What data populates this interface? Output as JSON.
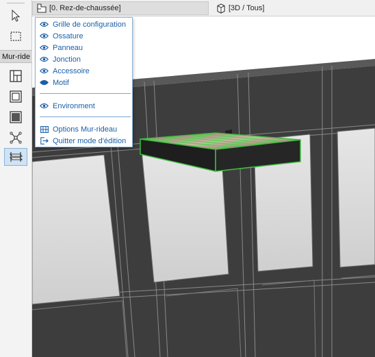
{
  "tabs": {
    "floor_plan": "[0. Rez-de-chaussée]",
    "view_3d": "[3D / Tous]"
  },
  "toolbox": {
    "panel_label": "Mur-ride"
  },
  "menu": {
    "visibility_items": [
      "Grille de configuration",
      "Ossature",
      "Panneau",
      "Jonction",
      "Accessoire",
      "Motif"
    ],
    "environment": "Environment",
    "options": "Options Mur-rideau",
    "exit": "Quitter mode d'édition"
  },
  "colors": {
    "menu_text": "#1a5fa8",
    "selection_outline": "#3fbf3f",
    "active_tool_bg": "#cfe3f5"
  }
}
